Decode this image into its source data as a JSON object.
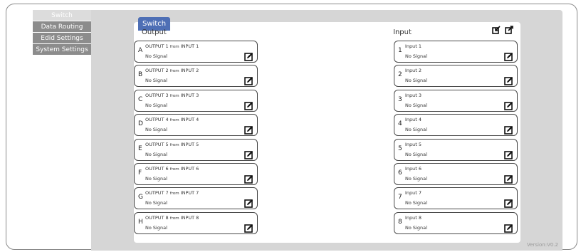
{
  "nav": {
    "items": [
      {
        "label": "Switch",
        "active": true
      },
      {
        "label": "Data Routing",
        "active": false
      },
      {
        "label": "Edid Settings",
        "active": false
      },
      {
        "label": "System Settings",
        "active": false
      }
    ]
  },
  "panel": {
    "tab_label": "Switch",
    "output_title": "Output",
    "input_title": "Input",
    "corner_icons": [
      "import-icon",
      "export-icon"
    ]
  },
  "outputs": [
    {
      "letter": "A",
      "name": "OUTPUT 1",
      "from": "from",
      "source": "INPUT 1",
      "status": "No Signal"
    },
    {
      "letter": "B",
      "name": "OUTPUT 2",
      "from": "from",
      "source": "INPUT 2",
      "status": "No Signal"
    },
    {
      "letter": "C",
      "name": "OUTPUT 3",
      "from": "from",
      "source": "INPUT 3",
      "status": "No Signal"
    },
    {
      "letter": "D",
      "name": "OUTPUT 4",
      "from": "from",
      "source": "INPUT 4",
      "status": "No Signal"
    },
    {
      "letter": "E",
      "name": "OUTPUT 5",
      "from": "from",
      "source": "INPUT 5",
      "status": "No Signal"
    },
    {
      "letter": "F",
      "name": "OUTPUT 6",
      "from": "from",
      "source": "INPUT 6",
      "status": "No Signal"
    },
    {
      "letter": "G",
      "name": "OUTPUT 7",
      "from": "from",
      "source": "INPUT 7",
      "status": "No Signal"
    },
    {
      "letter": "H",
      "name": "OUTPUT 8",
      "from": "from",
      "source": "INPUT 8",
      "status": "No Signal"
    }
  ],
  "inputs": [
    {
      "number": "1",
      "name": "Input 1",
      "status": "No Signal"
    },
    {
      "number": "2",
      "name": "Input 2",
      "status": "No Signal"
    },
    {
      "number": "3",
      "name": "Input 3",
      "status": "No Signal"
    },
    {
      "number": "4",
      "name": "Input 4",
      "status": "No Signal"
    },
    {
      "number": "5",
      "name": "Input 5",
      "status": "No Signal"
    },
    {
      "number": "6",
      "name": "Input 6",
      "status": "No Signal"
    },
    {
      "number": "7",
      "name": "Input 7",
      "status": "No Signal"
    },
    {
      "number": "8",
      "name": "Input 8",
      "status": "No Signal"
    }
  ],
  "footer": {
    "version": "Version:V0.2"
  },
  "colors": {
    "tab": "#4e6fb5",
    "nav": "#8c8c8c",
    "background": "#d6d6d6"
  }
}
